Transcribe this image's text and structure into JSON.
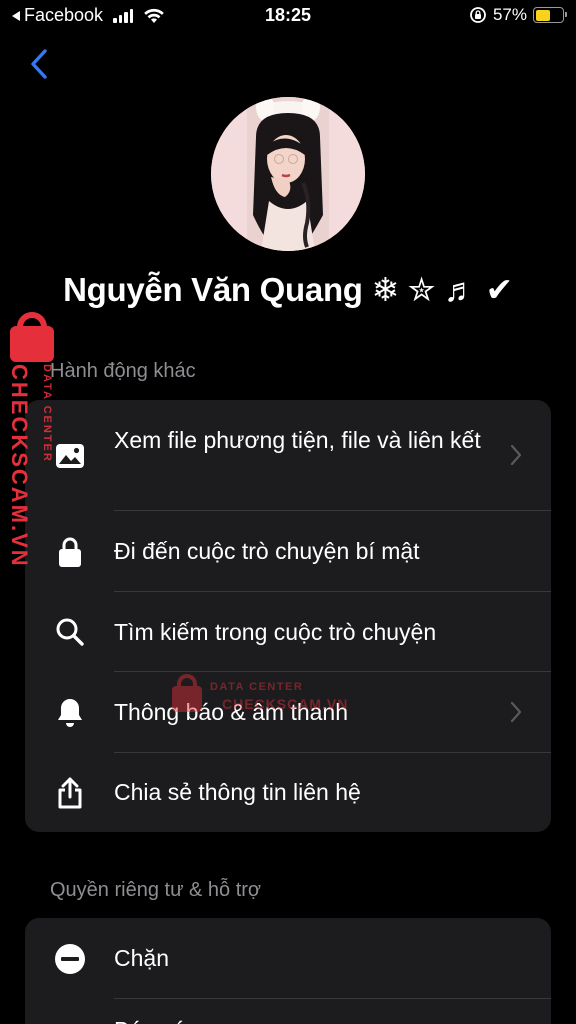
{
  "status_bar": {
    "back_app": "Facebook",
    "time": "18:25",
    "battery_percent": "57%",
    "battery_level": 0.57,
    "icons": [
      "signal-icon",
      "wifi-icon",
      "rotation-lock-icon",
      "battery-icon"
    ]
  },
  "profile": {
    "name": "Nguyễn Văn Quang ❄︎ ✮ ♬ ✔︎"
  },
  "sections": {
    "more_actions": {
      "title": "Hành động khác",
      "items": [
        {
          "label": "Xem file phương tiện, file và liên kết",
          "icon": "photo-icon",
          "chevron": true
        },
        {
          "label": "Đi đến cuộc trò chuyện bí mật",
          "icon": "lock-icon",
          "chevron": false
        },
        {
          "label": "Tìm kiếm trong cuộc trò chuyện",
          "icon": "search-icon",
          "chevron": false
        },
        {
          "label": "Thông báo & âm thanh",
          "icon": "bell-icon",
          "chevron": true
        },
        {
          "label": "Chia sẻ thông tin liên hệ",
          "icon": "share-icon",
          "chevron": false
        }
      ]
    },
    "privacy_support": {
      "title": "Quyền riêng tư & hỗ trợ",
      "items": [
        {
          "label": "Chặn",
          "icon": "block-icon",
          "chevron": false
        },
        {
          "label": "Báo cáo",
          "icon": "report-icon",
          "chevron": false
        }
      ]
    }
  },
  "watermark": {
    "brand": "CHECKSCAM.VN",
    "tagline": "DATA CENTER"
  },
  "colors": {
    "background": "#000000",
    "card": "#1c1c1e",
    "divider": "#38383a",
    "secondary_text": "#8e8e93",
    "accent_blue": "#3478f6",
    "battery_yellow": "#f9d21b",
    "watermark_red": "#e5303c"
  }
}
